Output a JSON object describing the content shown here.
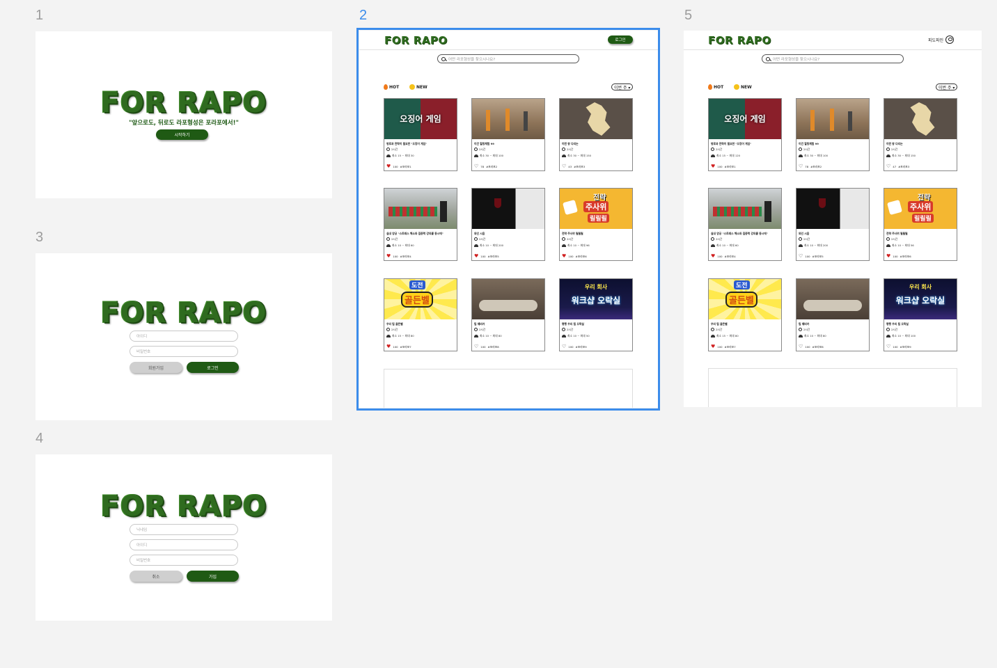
{
  "frames": {
    "f1": {
      "number": "1"
    },
    "f2": {
      "number": "2"
    },
    "f3": {
      "number": "3"
    },
    "f4": {
      "number": "4"
    },
    "f5": {
      "number": "5"
    }
  },
  "logo": "FOR RAPO",
  "splash": {
    "tagline": "\"앞으로도, 뒤로도 라포형성은 포라포에서!\"",
    "start_button": "시작하기"
  },
  "login_form": {
    "id_placeholder": "아이디",
    "pw_placeholder": "비밀번호",
    "signup_button": "회원가입",
    "login_button": "로그인"
  },
  "signup_form": {
    "nick_placeholder": "닉네임",
    "id_placeholder": "아이디",
    "pw_placeholder": "비밀번호",
    "cancel_button": "취소",
    "join_button": "가입"
  },
  "main": {
    "login_button": "로그인",
    "search_placeholder": "어떤 라포형성을 찾으시나요?",
    "hot_label": "HOT",
    "new_label": "NEW",
    "period_select": "이번 주 ▾",
    "profile_name": "피도파민"
  },
  "cards_f2": [
    {
      "title": "병로과 전략이 필요한 \"오징어 게임\"",
      "time": "2시간",
      "people": "최소 15 ~ 최대 30",
      "likes": "100",
      "tag": "#포라포1",
      "liked": true
    },
    {
      "title": "이건 힐링체험 99",
      "time": "2시간",
      "people": "최소 30 ~ 최대 100",
      "likes": "78",
      "tag": "#포라포2",
      "liked": false
    },
    {
      "title": "이런 왕 다리는",
      "time": "2시간",
      "people": "최소 30 ~ 최대 150",
      "likes": "43",
      "tag": "#포라포3",
      "liked": false
    },
    {
      "title": "실내 양궁 \"스트레스 해소와 집중력 강의를 동시에\"",
      "time": "2시간",
      "people": "최소 10 ~ 최대 60",
      "likes": "100",
      "tag": "#포라포4",
      "liked": true
    },
    {
      "title": "와인 시음",
      "time": "2시간",
      "people": "최소 10 ~ 최대 200",
      "likes": "100",
      "tag": "#포라포5",
      "liked": true
    },
    {
      "title": "전략 주사위 릴릴릴",
      "time": "2시간",
      "people": "최소 10 ~ 최대 96",
      "likes": "100",
      "tag": "#포라포6",
      "liked": true
    },
    {
      "title": "우리 팀 골든벨",
      "time": "2시간",
      "people": "최소 15 ~ 최대 80",
      "likes": "100",
      "tag": "#포라포7",
      "liked": true
    },
    {
      "title": "팀 웨비카",
      "time": "2시간",
      "people": "최소 10 ~ 최대 80",
      "likes": "100",
      "tag": "#포라포8",
      "liked": false
    },
    {
      "title": "평행 우리 팀 오락실",
      "time": "2시간",
      "people": "최소 10 ~ 최대 50",
      "likes": "100",
      "tag": "#포라포9",
      "liked": false
    }
  ],
  "cards_f5": [
    {
      "title": "병로과 전략이 필요한 \"오징어 게임\"",
      "time": "2시간",
      "people": "최소 15 ~ 최대 120",
      "likes": "100",
      "tag": "#포라포1",
      "liked": true
    },
    {
      "title": "이건 힐링체험 99",
      "time": "2시간",
      "people": "최소 30 ~ 최대 100",
      "likes": "78",
      "tag": "#포라포2",
      "liked": false
    },
    {
      "title": "이런 왕 다리는",
      "time": "2시간",
      "people": "최소 30 ~ 최대 150",
      "likes": "47",
      "tag": "#포라포3",
      "liked": false
    },
    {
      "title": "실내 양궁 \"스트레스 해소와 집중력 강의를 동시에\"",
      "time": "2시간",
      "people": "최소 10 ~ 최대 60",
      "likes": "100",
      "tag": "#포라포4",
      "liked": true
    },
    {
      "title": "와인 시음",
      "time": "2시간",
      "people": "최소 10 ~ 최대 200",
      "likes": "100",
      "tag": "#포라포5",
      "liked": false
    },
    {
      "title": "전략 주사위 릴릴릴",
      "time": "2시간",
      "people": "최소 10 ~ 최대 56",
      "likes": "100",
      "tag": "#포라포6",
      "liked": true
    },
    {
      "title": "우리 팀 골든벨",
      "time": "2시간",
      "people": "최소 15 ~ 최대 80",
      "likes": "100",
      "tag": "#포라포7",
      "liked": true
    },
    {
      "title": "팀 웨비카",
      "time": "2시간",
      "people": "최소 10 ~ 최대 80",
      "likes": "100",
      "tag": "#포라포8",
      "liked": false
    },
    {
      "title": "평행 우리 팀 오락실",
      "time": "2시간",
      "people": "최소 10 ~ 최대 100",
      "likes": "100",
      "tag": "#포라포9",
      "liked": false
    }
  ],
  "thumb_texts": {
    "squid": "오징어 게임",
    "dice_top": "전략",
    "dice_main": "주사위",
    "dice_sub": "릴릴릴",
    "golden_top": "도전",
    "golden_main": "골든벨",
    "arcade_top": "우리 회사",
    "arcade_main": "워크샵 오락실"
  },
  "colors": {
    "brand_green": "#1f5a14",
    "logo_green": "#2f6b1f",
    "selection_blue": "#3b8ceb",
    "like_red": "#d02020"
  }
}
